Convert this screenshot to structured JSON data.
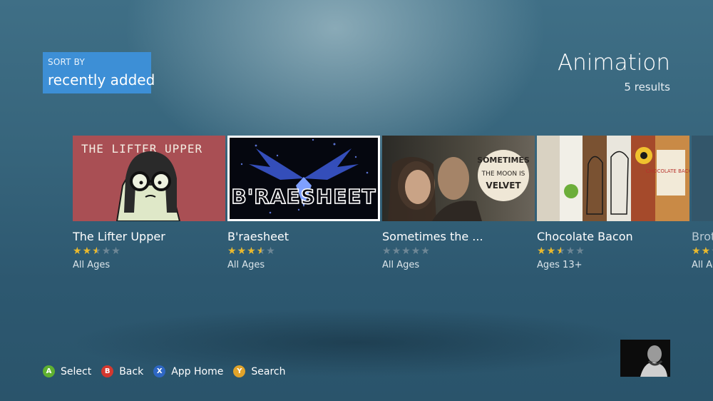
{
  "sort": {
    "label": "SORT BY",
    "value": "recently added"
  },
  "header": {
    "title": "Animation",
    "result_count": "5 results"
  },
  "items": [
    {
      "title": "The Lifter Upper",
      "thumb_text": "THE LIFTER UPPER",
      "rating": 2.5,
      "age": "All Ages"
    },
    {
      "title": "B'raesheet",
      "thumb_text": "B'RAESHEET",
      "rating": 3.5,
      "age": "All Ages"
    },
    {
      "title": "Sometimes the ...",
      "thumb_text": [
        "SOMETIMES",
        "THE MOON IS",
        "VELVET"
      ],
      "rating": 0,
      "age": "All Ages"
    },
    {
      "title": "Chocolate Bacon",
      "thumb_text": "CHOCOLATE BACON",
      "rating": 2.5,
      "age": "Ages 13+"
    },
    {
      "title": "Brot",
      "rating": 2,
      "age": "All Ag"
    }
  ],
  "footer": {
    "hints": [
      {
        "key": "A",
        "label": "Select",
        "color": "#5fb130"
      },
      {
        "key": "B",
        "label": "Back",
        "color": "#d4382f"
      },
      {
        "key": "X",
        "label": "App Home",
        "color": "#2e67c4"
      },
      {
        "key": "Y",
        "label": "Search",
        "color": "#e1a32a"
      }
    ]
  }
}
